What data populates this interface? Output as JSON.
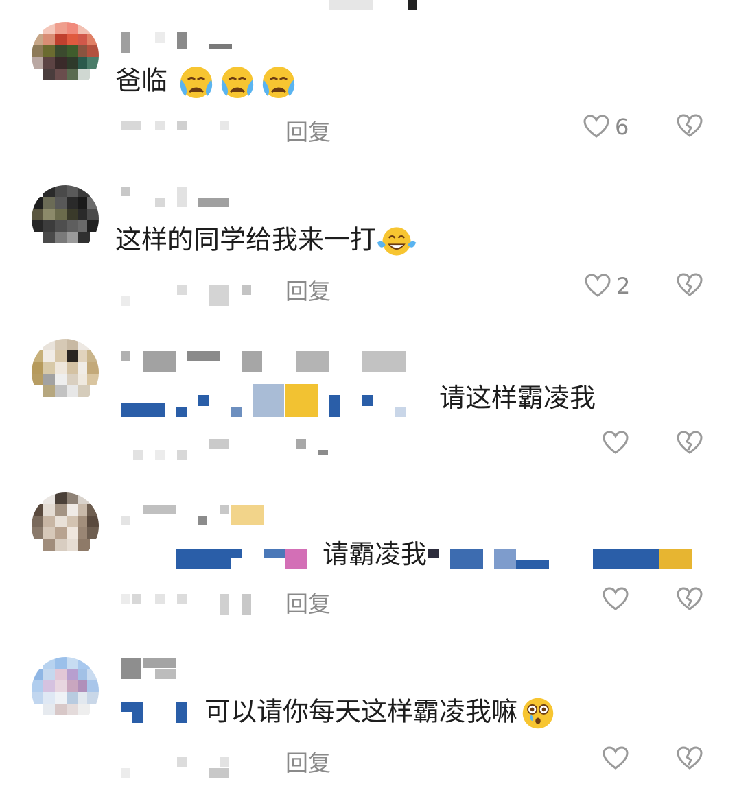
{
  "comments": [
    {
      "text": "爸临",
      "emojis": [
        "crying-emoji",
        "crying-emoji",
        "crying-emoji"
      ],
      "reply_label": "回复",
      "like_count": "6"
    },
    {
      "text": "这样的同学给我来一打",
      "emojis": [
        "laughing-tears-emoji"
      ],
      "reply_label": "回复",
      "like_count": "2"
    },
    {
      "text": "请这样霸凌我",
      "emojis": [],
      "reply_label": "",
      "like_count": ""
    },
    {
      "text": "请霸凌我",
      "emojis": [],
      "reply_label": "回复",
      "like_count": ""
    },
    {
      "text": "可以请你每天这样霸凌我嘛",
      "emojis": [
        "tearful-shocked-emoji"
      ],
      "reply_label": "回复",
      "like_count": ""
    }
  ],
  "icons": {
    "like": "heart-outline-icon",
    "dislike": "broken-heart-icon"
  },
  "colors": {
    "text": "#1d1d1d",
    "muted": "#8a8a8a",
    "icon": "#9a9a9a"
  }
}
